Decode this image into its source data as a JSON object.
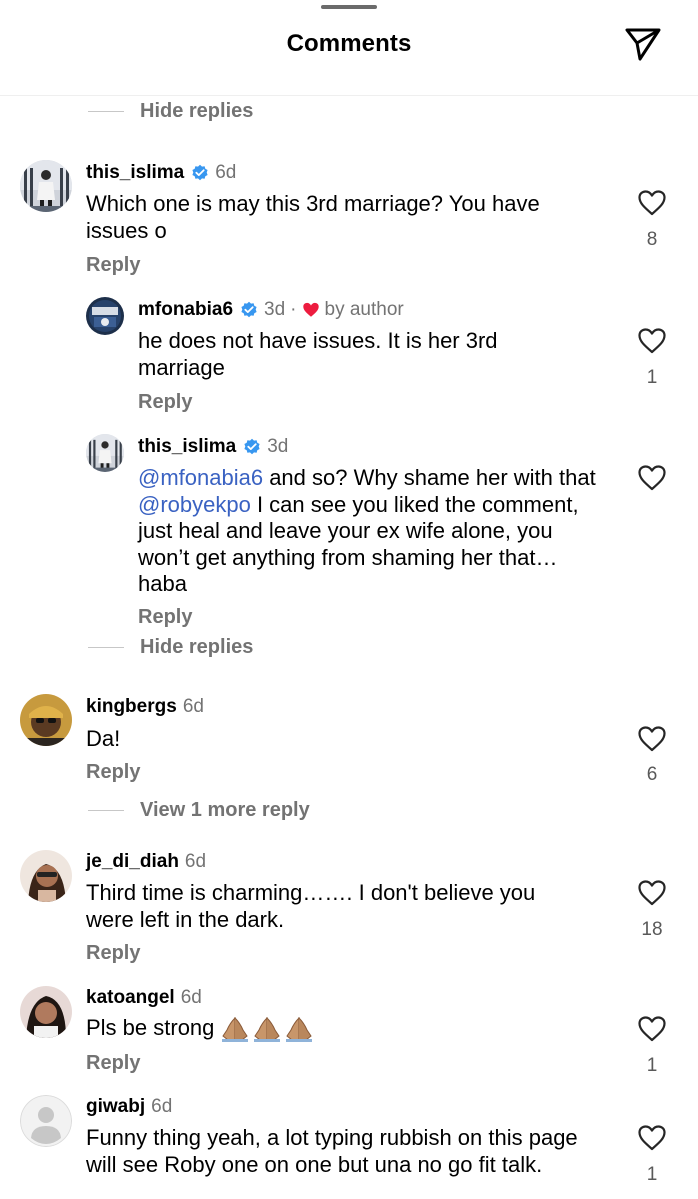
{
  "header": {
    "title": "Comments",
    "share_icon": "send-icon"
  },
  "threads": {
    "hide_replies_1": "Hide replies",
    "hide_replies_2": "Hide replies",
    "view_more": "View 1 more reply"
  },
  "comments": [
    {
      "username": "this_islima",
      "time": "6d",
      "text": "Which one is may this 3rd marriage? You have issues o",
      "reply": "Reply",
      "likes": "8",
      "verified": true
    },
    {
      "username": "mfonabia6",
      "time": "3d",
      "author_label": "by author",
      "text": "he does not have issues. It is her 3rd marriage",
      "reply": "Reply",
      "likes": "1",
      "verified": true
    },
    {
      "username": "this_islima",
      "time": "3d",
      "mention1": "@mfonabia6",
      "text_part1": " and so? Why shame her with that ",
      "mention2": "@robyekpo",
      "text_part2": " I can see you liked the comment, just heal and leave your ex wife alone, you won’t get anything from shaming her that… haba",
      "reply": "Reply",
      "verified": true
    },
    {
      "username": "kingbergs",
      "time": "6d",
      "text": "Da!",
      "reply": "Reply",
      "likes": "6"
    },
    {
      "username": "je_di_diah",
      "time": "6d",
      "text": "Third time is charming……. I don't believe you were left in the dark.",
      "reply": "Reply",
      "likes": "18"
    },
    {
      "username": "katoangel",
      "time": "6d",
      "text": "Pls be strong",
      "reply": "Reply",
      "likes": "1",
      "emoji": "praying-hands"
    },
    {
      "username": "giwabj",
      "time": "6d",
      "text": "Funny thing yeah, a lot typing rubbish on this page will see Roby one on  one but una no go fit talk.",
      "likes": "1"
    }
  ],
  "colors": {
    "secondary_text": "#737373",
    "mention": "#3a62c2",
    "verified": "#3897f0",
    "heart_red": "#ed1c3f"
  }
}
